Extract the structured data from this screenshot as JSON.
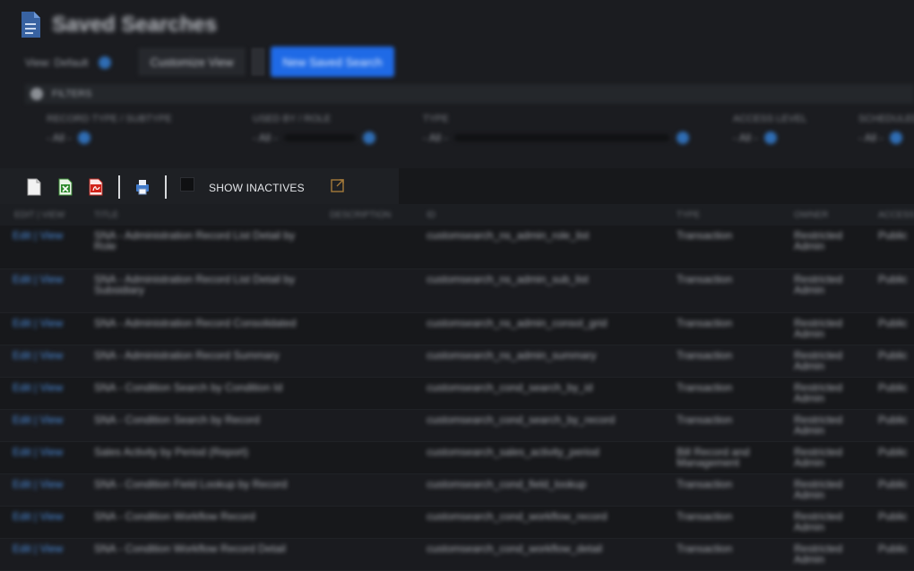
{
  "header": {
    "title": "Saved Searches",
    "view_label": "View: Default",
    "customize_button": "Customize View",
    "new_button": "New Saved Search"
  },
  "filters": {
    "toggle_label": "FILTERS",
    "fields": [
      {
        "label": "RECORD TYPE / SUBTYPE",
        "value": "- All -"
      },
      {
        "label": "USED BY / ROLE",
        "value": "- All -"
      },
      {
        "label": "TYPE",
        "value": "- All -"
      },
      {
        "label": "ACCESS LEVEL",
        "value": "- All -"
      },
      {
        "label": "SCHEDULED",
        "value": "- All -"
      }
    ]
  },
  "toolbar": {
    "show_inactives_label": "SHOW INACTIVES"
  },
  "table": {
    "columns": [
      "EDIT | VIEW",
      "TITLE",
      "DESCRIPTION",
      "ID",
      "TYPE",
      "OWNER",
      "ACCESS"
    ],
    "rows": [
      {
        "link": "Edit | View",
        "name": "SNA - Administration Record List Detail by Role",
        "id": "customsearch_ns_admin_role_list",
        "type": "Transaction",
        "owner": "Restricted Admin",
        "last": "Public"
      },
      {
        "link": "Edit | View",
        "name": "SNA - Administration Record List Detail by Subsidiary",
        "id": "customsearch_ns_admin_sub_list",
        "type": "Transaction",
        "owner": "Restricted Admin",
        "last": "Public"
      },
      {
        "link": "Edit | View",
        "name": "SNA - Administration Record Consolidated",
        "id": "customsearch_ns_admin_consol_grid",
        "type": "Transaction",
        "owner": "Restricted Admin",
        "last": "Public"
      },
      {
        "link": "Edit | View",
        "name": "SNA - Administration Record Summary",
        "id": "customsearch_ns_admin_summary",
        "type": "Transaction",
        "owner": "Restricted Admin",
        "last": "Public"
      },
      {
        "link": "Edit | View",
        "name": "SNA - Condition Search by Condition Id",
        "id": "customsearch_cond_search_by_id",
        "type": "Transaction",
        "owner": "Restricted Admin",
        "last": "Public"
      },
      {
        "link": "Edit | View",
        "name": "SNA - Condition Search by Record",
        "id": "customsearch_cond_search_by_record",
        "type": "Transaction",
        "owner": "Restricted Admin",
        "last": "Public"
      },
      {
        "link": "Edit | View",
        "name": "Sales Activity by Period (Report)",
        "id": "customsearch_sales_activity_period",
        "type": "Bill Record and Management",
        "owner": "Restricted Admin",
        "last": "Public"
      },
      {
        "link": "Edit | View",
        "name": "SNA - Condition Field Lookup by Record",
        "id": "customsearch_cond_field_lookup",
        "type": "Transaction",
        "owner": "Restricted Admin",
        "last": "Public"
      },
      {
        "link": "Edit | View",
        "name": "SNA - Condition Workflow Record",
        "id": "customsearch_cond_workflow_record",
        "type": "Transaction",
        "owner": "Restricted Admin",
        "last": "Public"
      },
      {
        "link": "Edit | View",
        "name": "SNA - Condition Workflow Record Detail",
        "id": "customsearch_cond_workflow_detail",
        "type": "Transaction",
        "owner": "Restricted Admin",
        "last": "Public"
      }
    ]
  }
}
